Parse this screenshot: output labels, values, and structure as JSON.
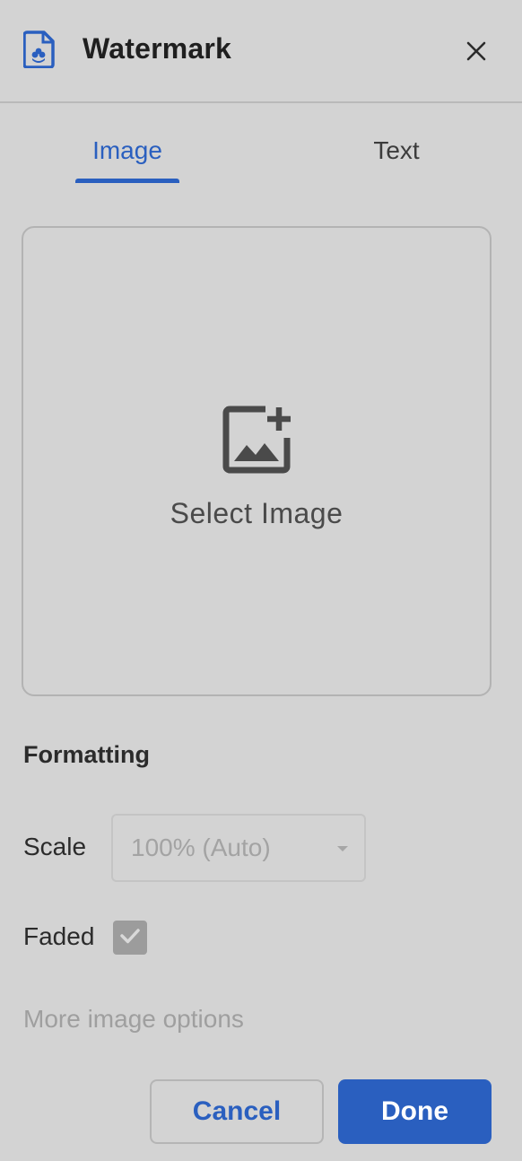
{
  "header": {
    "title": "Watermark",
    "icon": "watermark-doc-icon",
    "close_icon": "close-icon"
  },
  "tabs": [
    {
      "label": "Image",
      "selected": true
    },
    {
      "label": "Text",
      "selected": false
    }
  ],
  "image_picker": {
    "label": "Select Image",
    "icon": "add-photo-icon"
  },
  "formatting": {
    "title": "Formatting",
    "scale": {
      "label": "Scale",
      "value": "100% (Auto)",
      "disabled": true
    },
    "faded": {
      "label": "Faded",
      "checked": true,
      "disabled": true
    },
    "more_options": "More image options"
  },
  "actions": {
    "cancel": "Cancel",
    "done": "Done"
  },
  "colors": {
    "accent": "#2a5fbf",
    "background": "#d3d3d3",
    "disabled_text": "#a3a3a3"
  }
}
